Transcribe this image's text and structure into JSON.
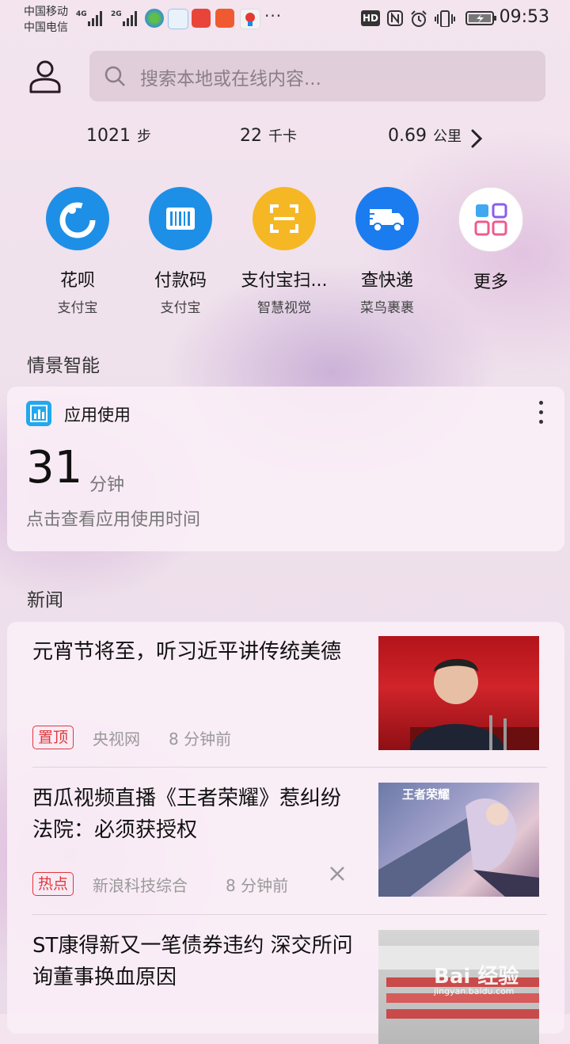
{
  "status_bar": {
    "carrier1": "中国移动",
    "carrier2": "中国电信",
    "net1": "4G",
    "net2": "2G",
    "hd": "HD",
    "time": "09:53",
    "more": "···"
  },
  "search": {
    "placeholder": "搜索本地或在线内容..."
  },
  "stats": {
    "steps_value": "1021",
    "steps_unit": "步",
    "kcal_value": "22",
    "kcal_unit": "千卡",
    "km_value": "0.69",
    "km_unit": "公里"
  },
  "shortcuts": [
    {
      "title": "花呗",
      "subtitle": "支付宝",
      "color": "#1e8fe6",
      "icon": "huabei-icon"
    },
    {
      "title": "付款码",
      "subtitle": "支付宝",
      "color": "#1e8fe6",
      "icon": "barcode-icon"
    },
    {
      "title": "支付宝扫...",
      "subtitle": "智慧视觉",
      "color": "#f6b724",
      "icon": "scan-icon"
    },
    {
      "title": "查快递",
      "subtitle": "菜鸟裹裹",
      "color": "#1b7cf0",
      "icon": "delivery-truck-icon"
    },
    {
      "title": "更多",
      "subtitle": "",
      "color": "#ffffff",
      "icon": "grid-apps-icon"
    }
  ],
  "smart_section": {
    "title": "情景智能",
    "card_title": "应用使用",
    "usage_value": "31",
    "usage_unit": "分钟",
    "description": "点击查看应用使用时间"
  },
  "news_section": {
    "title": "新闻",
    "items": [
      {
        "title": "元宵节将至，听习近平讲传统美德",
        "tag": "置顶",
        "source": "央视网",
        "time": "8 分钟前"
      },
      {
        "title": "西瓜视频直播《王者荣耀》惹纠纷 法院：必须获授权",
        "tag": "热点",
        "source": "新浪科技综合",
        "time": "8 分钟前"
      },
      {
        "title": "ST康得新又一笔债券违约 深交所问询董事换血原因",
        "tag": "",
        "source": "",
        "time": ""
      }
    ]
  },
  "thumbnail_texts": {
    "game_logo": "王者荣耀"
  },
  "watermark": {
    "main": "Bai 经验",
    "sub": "jingyan.baidu.com"
  }
}
